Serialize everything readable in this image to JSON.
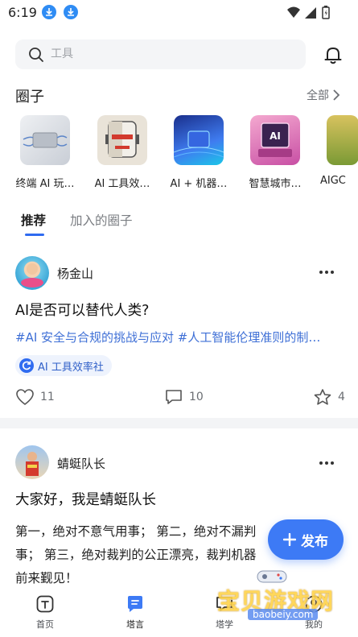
{
  "status_bar": {
    "time": "6:19"
  },
  "search": {
    "placeholder": "工具"
  },
  "circles": {
    "title": "圈子",
    "see_all": "全部",
    "items": [
      {
        "label": "终端 AI 玩…"
      },
      {
        "label": "AI 工具效…"
      },
      {
        "label": "AI + 机器…"
      },
      {
        "label": "智慧城市…"
      },
      {
        "label": "AIGC"
      }
    ]
  },
  "tabs": [
    {
      "label": "推荐",
      "active": true
    },
    {
      "label": "加入的圈子",
      "active": false
    }
  ],
  "posts": [
    {
      "author": "杨金山",
      "title": "AI是否可以替代人类?",
      "hashtags": "#AI 安全与合规的挑战与应对 #人工智能伦理准则的制…",
      "circle_tag": "AI 工具效率社",
      "likes": "11",
      "comments": "10",
      "shares": "4"
    },
    {
      "author": "蜻蜓队长",
      "title": "大家好，我是蜻蜓队长",
      "body_line1": "第一，绝对不意气用事； 第二，绝对不漏判",
      "body_line2": "事； 第三，绝对裁判的公正漂亮，裁判机器",
      "body_line3": "前来觐见！"
    }
  ],
  "fab": {
    "label": "发布"
  },
  "bottom_nav": [
    {
      "label": "首页"
    },
    {
      "label": "塔言"
    },
    {
      "label": "塔学"
    },
    {
      "label": "我的"
    }
  ],
  "watermark": {
    "text": "宝贝游戏网",
    "url": "baobeiy.com"
  },
  "colors": {
    "accent": "#3d7af5",
    "hashtag": "#3e6fd6",
    "indicator": "#2f6bf0"
  }
}
